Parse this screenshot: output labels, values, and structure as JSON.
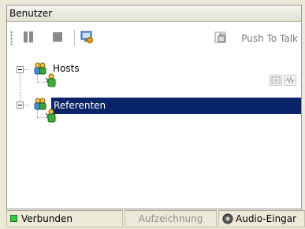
{
  "panel": {
    "title": "Benutzer"
  },
  "toolbar": {
    "pause_icon": "pause-icon",
    "stop_icon": "stop-icon",
    "connect_icon": "monitor-icon",
    "push_to_talk_label": "Push To Talk",
    "push_to_talk_icon": "hand-icon"
  },
  "tree": {
    "groups": [
      {
        "label": "Hosts",
        "expanded": true,
        "users": 1
      },
      {
        "label": "Referenten",
        "expanded": true,
        "selected": true,
        "users": 1
      }
    ]
  },
  "status": {
    "connected_label": "Verbunden",
    "recording_label": "Aufzeichnung",
    "audio_label": "Audio-Eingar"
  },
  "colors": {
    "selection": "#0a246a",
    "led_connected": "#2ecc40"
  }
}
